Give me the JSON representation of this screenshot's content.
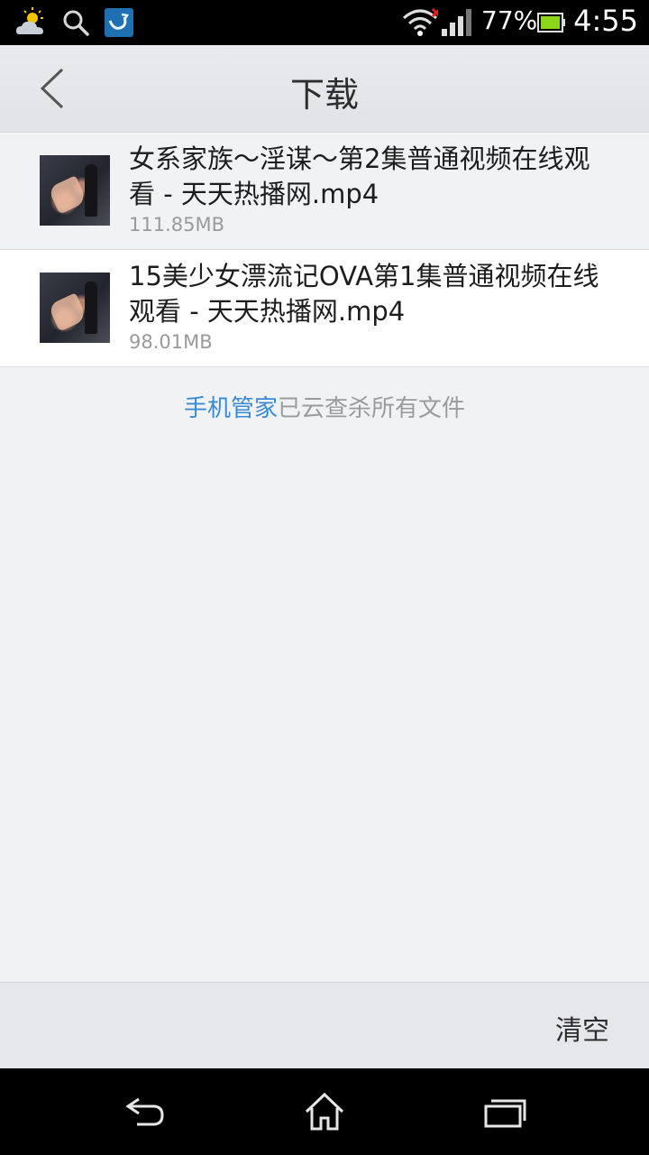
{
  "status_bar": {
    "battery_percent": "77%",
    "time": "4:55",
    "icons": [
      "weather-icon",
      "search-icon",
      "app-icon",
      "wifi-icon",
      "signal-icon",
      "battery-icon"
    ]
  },
  "header": {
    "title": "下载",
    "back_icon": "chevron-left-icon"
  },
  "downloads": [
    {
      "title": "女系家族～淫谋～第2集普通视频在线观看 - 天天热播网.mp4",
      "size": "111.85MB"
    },
    {
      "title": "15美少女漂流记OVA第1集普通视频在线观看 - 天天热播网.mp4",
      "size": "98.01MB"
    }
  ],
  "scan_note": {
    "link": "手机管家",
    "text": "已云查杀所有文件"
  },
  "bottom_bar": {
    "clear_label": "清空"
  },
  "nav_bar": {
    "icons": [
      "back-icon",
      "home-icon",
      "recent-apps-icon"
    ]
  },
  "colors": {
    "accent": "#3a8ad6",
    "background": "#f1f2f4",
    "battery": "#8ed61a"
  }
}
